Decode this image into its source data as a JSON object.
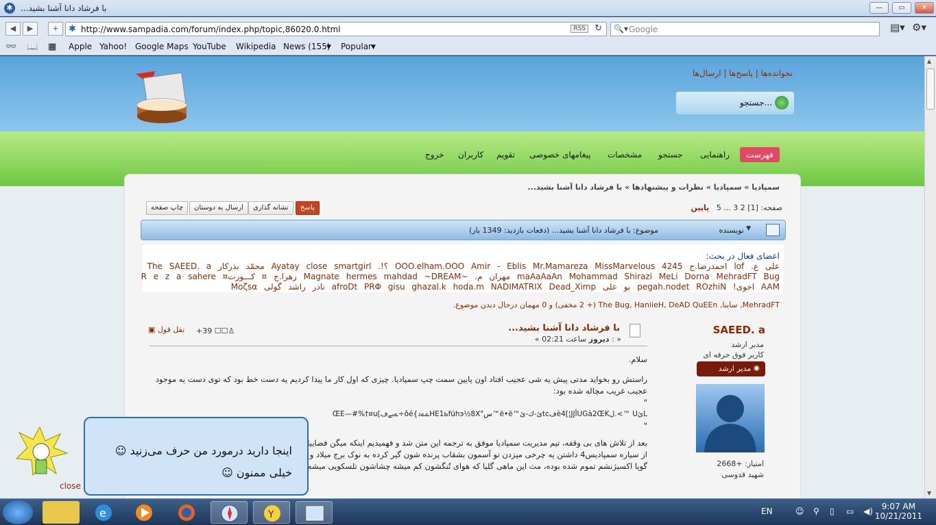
{
  "window": {
    "title": "با فرشاد دانا آشنا بشید...",
    "min": "—",
    "max": "▭",
    "close": "✕"
  },
  "nav": {
    "url": "http://www.sampadia.com/forum/index.php/topic,86020.0.html",
    "rss": "RSS",
    "search_placeholder": "Google"
  },
  "bookmarks": [
    "Apple",
    "Yahoo!",
    "Google Maps",
    "YouTube",
    "Wikipedia",
    "News (155)",
    "Popular"
  ],
  "site": {
    "toplinks": "نخوانده‌ها | پاسخ‌ها | ارسال‌ها",
    "search_label": "جستجو...",
    "menu": [
      "فهرست",
      "راهنمایی",
      "جستجو",
      "مشخصات",
      "پیغامهای خصوصی",
      "تقویم",
      "کاربران",
      "خروج"
    ]
  },
  "topic": {
    "breadcrumb": "سمپادیا » سمپادیا » نظرات و پیشنهادها » با فرشاد دانا آشنا بشید...",
    "pages": "صفحه: [1] 2 3 ... 5",
    "bottom_link": "پایین",
    "buttons": {
      "reply": "پاسخ",
      "bookmark": "نشانه گذاری",
      "send": "ارسال به دوستان",
      "print": "چاپ صفحه"
    },
    "author_header": "نویسنده",
    "subject_header": "موضوع: با فرشاد دانا آشنا بشید...  (دفعات بازدید: 1349 بار)"
  },
  "members": {
    "heading": "اعضای فعال در بحث:",
    "line1": "علی ع.  lof  احمدرضا.ج  4245  OOO.elham.OOO  Amir - Eblis  Mr.Mamareza  MissMarvelous  ؟!.  Ayatay  close  smartgirl  محمّد بذرکار  The  SAEED. a",
    "line2": "maAaAaAn  Mohammad Shirazi  MeLi  Dorna  MehradFT  Bug  مهران م.  ~Magnate  hermes  mahdad  ~DREAM  زهرا.ج  ¤ کـــوزت¤  R e z a  sahere",
    "line3": "AAM  اخوی!  pegah.nodet  ROzhiN  بو علی  afroDt  PRΦ  gisu  ghazal.k  hoda.m  NADIMATRIX  Dead_Ximp  نادر راشد  گولی  Moζsα"
  },
  "guests": {
    "names": "MehradFT, ساینا, The Bug, HaniieH, DeAD QuEEn",
    "rest": " (+ 2 مخفی) و 0 مهمان درحال دیدن موضوع."
  },
  "post": {
    "title": "با فرشاد دانا آشنا بشید...",
    "date_prefix": "« : ",
    "date_day": "دیروز",
    "date_time": " ساعت 02:21 »",
    "karma": "+39",
    "quote": "نقل قول",
    "body": [
      "سلام.",
      "راستش رو بخواید مدتی پیش یه شی عجیب افتاد اون پایین سمت چپ سمپادیا. چیزی که اول کار ما پیدا کردیم یه دست خط بود که توی دست یه موجود عجیب غریب مچاله شده بود:",
      "\"",
      "ŒE—#%†¤u[ےبےف÷ôé{ےےدHE1ьfühэ½8X\"س™ë•ë™ئ-ك-ئtcفè4[¦JJأUGà2ŒKل.<™ UئL",
      "\"",
      "بعد از تلاش های بی وقفه، تیم مدیریت سمپادیا موفق به ترجمه این متن شد و فهمیدیم اینکه میگن فضاییا وجود دارن واقعیت داره. این موجود",
      "از سیاره سمپادیس4 داشتن یه چرخی میزدن تو آسمون بشقاب پرنده شون گیر کرده به نوک برج میلاد و سقوط کرده تو زمین و الانم",
      "گویا اکسیژنشم تموم شده بوده، مث این ماهی گلیا که هوای تُنگشون کم میشه چشاشون تلسکوپی میشه"
    ]
  },
  "author": {
    "name": "SAEED. a",
    "role1": "مدیر ارشد",
    "role2": "کاربر فوق حرفه ای",
    "badge": "مدیر ارشد",
    "score": "امتیاز: +2668",
    "status": "شهید قدوسی"
  },
  "popup": {
    "line1": "اینجا دارید درمورد من حرف می‌زنید",
    "line2": "خیلی ممنون",
    "close": "close"
  },
  "taskbar": {
    "lang": "EN",
    "time": "9:07 AM",
    "date": "10/21/2011"
  }
}
